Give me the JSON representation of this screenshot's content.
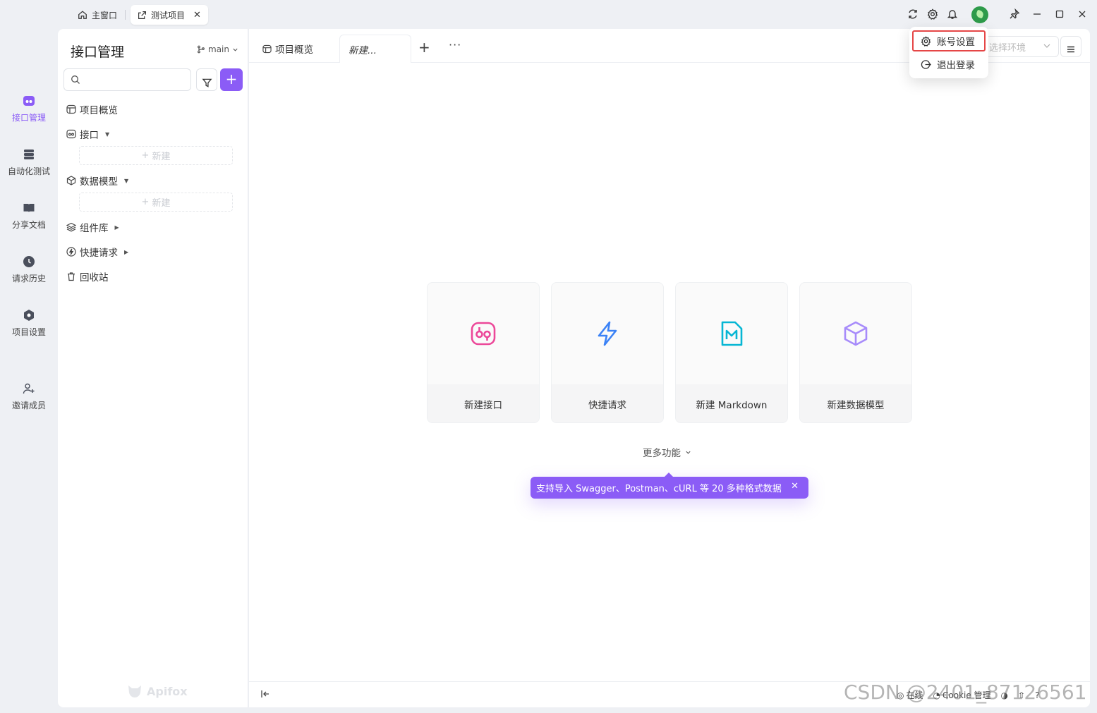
{
  "window": {
    "tabs": [
      {
        "label": "主窗口",
        "icon": "home-icon"
      },
      {
        "label": "测试项目",
        "icon": "external-link-icon"
      }
    ]
  },
  "account_menu": {
    "items": [
      {
        "label": "账号设置",
        "icon": "gear-icon"
      },
      {
        "label": "退出登录",
        "icon": "logout-icon"
      }
    ]
  },
  "rail": {
    "items": [
      {
        "label": "接口管理",
        "icon": "api-icon",
        "active": true
      },
      {
        "label": "自动化测试",
        "icon": "stack-icon"
      },
      {
        "label": "分享文档",
        "icon": "book-icon"
      },
      {
        "label": "请求历史",
        "icon": "clock-icon"
      },
      {
        "label": "项目设置",
        "icon": "hexagon-icon"
      },
      {
        "label": "邀请成员",
        "icon": "add-user-icon"
      }
    ]
  },
  "sidebar": {
    "title": "接口管理",
    "branch": "main",
    "tree": [
      {
        "label": "项目概览"
      },
      {
        "label": "接口"
      },
      {
        "label": "数据模型"
      },
      {
        "label": "组件库"
      },
      {
        "label": "快捷请求"
      },
      {
        "label": "回收站"
      }
    ],
    "new_label": "新建",
    "brand": "Apifox"
  },
  "main": {
    "tabs": [
      {
        "label": "项目概览"
      },
      {
        "label": "新建..."
      }
    ],
    "env_placeholder": "选择环境",
    "cards": [
      {
        "label": "新建接口",
        "icon": "api-icon",
        "color": "#ec4899"
      },
      {
        "label": "快捷请求",
        "icon": "lightning-icon",
        "color": "#3b82f6"
      },
      {
        "label": "新建 Markdown",
        "icon": "markdown-icon",
        "color": "#06b6d4"
      },
      {
        "label": "新建数据模型",
        "icon": "cube-icon",
        "color": "#a78bfa"
      }
    ],
    "more_label": "更多功能",
    "tooltip": "支持导入 Swagger、Postman、cURL 等 20 多种格式数据",
    "status": {
      "online": "在线",
      "cookie": "Cookie 管理"
    }
  },
  "watermark": "CSDN @2401_87126561",
  "colors": {
    "accent": "#8b5cf6",
    "highlight_border": "#e54646"
  }
}
